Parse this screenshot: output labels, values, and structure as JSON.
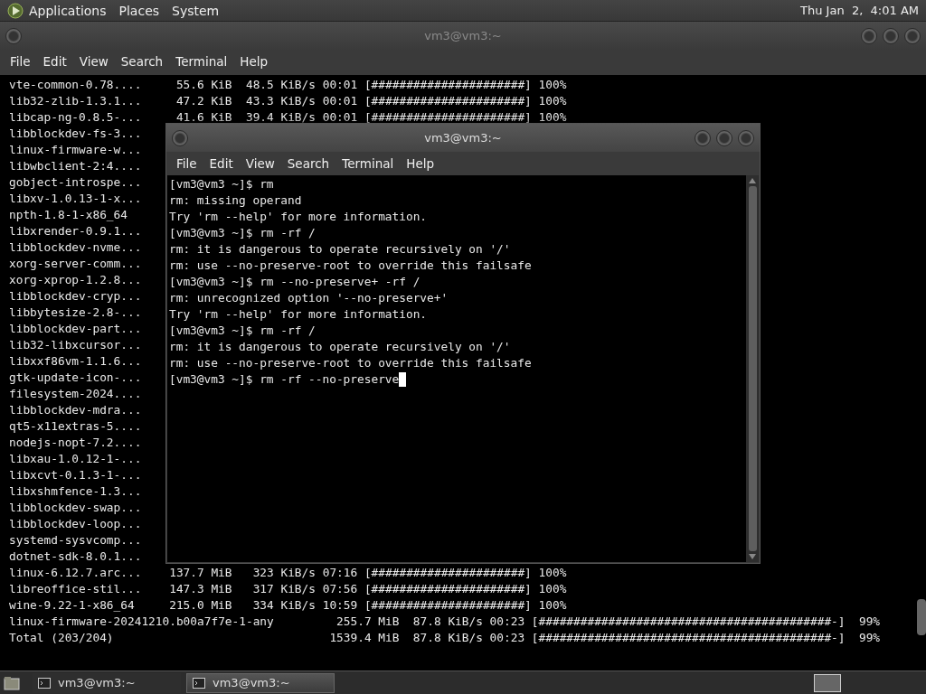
{
  "top_panel": {
    "menus": [
      "Applications",
      "Places",
      "System"
    ],
    "clock": "Thu Jan  2,  4:01 AM"
  },
  "back_window": {
    "title": "vm3@vm3:~",
    "menu": [
      "File",
      "Edit",
      "View",
      "Search",
      "Terminal",
      "Help"
    ],
    "rows": [
      {
        "name": "vte-common-0.78....",
        "stats": " 55.6 KiB  48.5 KiB/s 00:01 [######################] 100%"
      },
      {
        "name": "lib32-zlib-1.3.1...",
        "stats": " 47.2 KiB  43.3 KiB/s 00:01 [######################] 100%"
      },
      {
        "name": "libcap-ng-0.8.5-...",
        "stats": " 41.6 KiB  39.4 KiB/s 00:01 [######################] 100%"
      },
      {
        "name": "libblockdev-fs-3..."
      },
      {
        "name": "linux-firmware-w..."
      },
      {
        "name": "libwbclient-2:4...."
      },
      {
        "name": "gobject-introspe..."
      },
      {
        "name": "libxv-1.0.13-1-x..."
      },
      {
        "name": "npth-1.8-1-x86_64"
      },
      {
        "name": "libxrender-0.9.1..."
      },
      {
        "name": "libblockdev-nvme..."
      },
      {
        "name": "xorg-server-comm..."
      },
      {
        "name": "xorg-xprop-1.2.8..."
      },
      {
        "name": "libblockdev-cryp..."
      },
      {
        "name": "libbytesize-2.8-..."
      },
      {
        "name": "libblockdev-part..."
      },
      {
        "name": "lib32-libxcursor..."
      },
      {
        "name": "libxxf86vm-1.1.6..."
      },
      {
        "name": "gtk-update-icon-..."
      },
      {
        "name": "filesystem-2024...."
      },
      {
        "name": "libblockdev-mdra..."
      },
      {
        "name": "qt5-x11extras-5...."
      },
      {
        "name": "nodejs-nopt-7.2...."
      },
      {
        "name": "libxau-1.0.12-1-..."
      },
      {
        "name": "libxcvt-0.1.3-1-..."
      },
      {
        "name": "libxshmfence-1.3..."
      },
      {
        "name": "libblockdev-swap..."
      },
      {
        "name": "libblockdev-loop..."
      },
      {
        "name": "systemd-sysvcomp..."
      },
      {
        "name": "dotnet-sdk-8.0.1..."
      },
      {
        "name": "linux-6.12.7.arc...",
        "stats": "137.7 MiB   323 KiB/s 07:16 [######################] 100%"
      },
      {
        "name": "libreoffice-stil...",
        "stats": "147.3 MiB   317 KiB/s 07:56 [######################] 100%"
      },
      {
        "name": "wine-9.22-1-x86_64",
        "stats": "215.0 MiB   334 KiB/s 10:59 [######################] 100%"
      }
    ],
    "footer_lines": [
      "linux-firmware-20241210.b00a7f7e-1-any         255.7 MiB  87.8 KiB/s 00:23 [##########################################-]  99%",
      "Total (203/204)                               1539.4 MiB  87.8 KiB/s 00:23 [##########################################-]  99%"
    ]
  },
  "front_window": {
    "title": "vm3@vm3:~",
    "menu": [
      "File",
      "Edit",
      "View",
      "Search",
      "Terminal",
      "Help"
    ],
    "lines": [
      "[vm3@vm3 ~]$ rm",
      "rm: missing operand",
      "Try 'rm --help' for more information.",
      "[vm3@vm3 ~]$ rm -rf /",
      "rm: it is dangerous to operate recursively on '/'",
      "rm: use --no-preserve-root to override this failsafe",
      "[vm3@vm3 ~]$ rm --no-preserve+ -rf /",
      "rm: unrecognized option '--no-preserve+'",
      "Try 'rm --help' for more information.",
      "[vm3@vm3 ~]$ rm -rf /",
      "rm: it is dangerous to operate recursively on '/'",
      "rm: use --no-preserve-root to override this failsafe"
    ],
    "input": "[vm3@vm3 ~]$ rm -rf --no-preserve"
  },
  "taskbar": {
    "tasks": [
      {
        "label": "vm3@vm3:~",
        "selected": false
      },
      {
        "label": "vm3@vm3:~",
        "selected": true
      }
    ]
  }
}
